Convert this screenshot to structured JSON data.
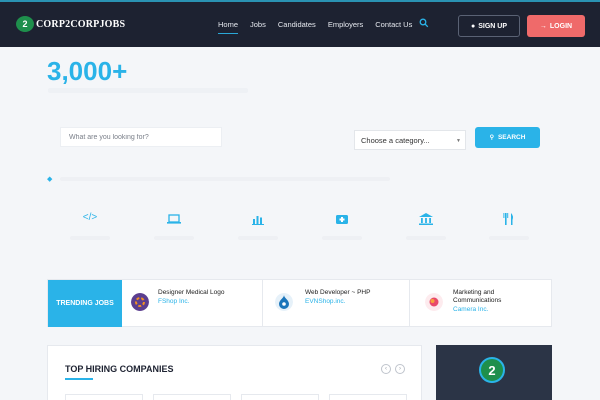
{
  "header": {
    "logo_mark": "2",
    "logo_text": "CORP2CORPJOBS",
    "nav": [
      "Home",
      "Jobs",
      "Candidates",
      "Employers",
      "Contact Us"
    ],
    "signup_label": "SIGN UP",
    "login_label": "LOGIN"
  },
  "hero": {
    "count": "3,000+",
    "title_rest": "Browse Jobs"
  },
  "search": {
    "placeholder": "What are you looking for?",
    "category_value": "Choose a category...",
    "button_label": "SEARCH"
  },
  "trending": {
    "label": "TRENDING JOBS",
    "jobs": [
      {
        "title": "Designer Medical Logo",
        "company": "FShop Inc."
      },
      {
        "title": "Web Developer ~ PHP",
        "company": "EVNShop.inc."
      },
      {
        "title": "Marketing and Communications",
        "company": "Camera Inc."
      }
    ]
  },
  "companies": {
    "title": "TOP HIRING COMPANIES"
  },
  "promo": {
    "logo_mark": "2"
  },
  "icons": {
    "categories": [
      "code-icon",
      "laptop-icon",
      "bar-chart-icon",
      "medkit-icon",
      "bank-icon",
      "cutlery-icon"
    ]
  },
  "colors": {
    "accent": "#2ab3e8",
    "header_bg": "#1d2231",
    "login": "#ef6a6a",
    "logo_green": "#1e8f4c"
  }
}
